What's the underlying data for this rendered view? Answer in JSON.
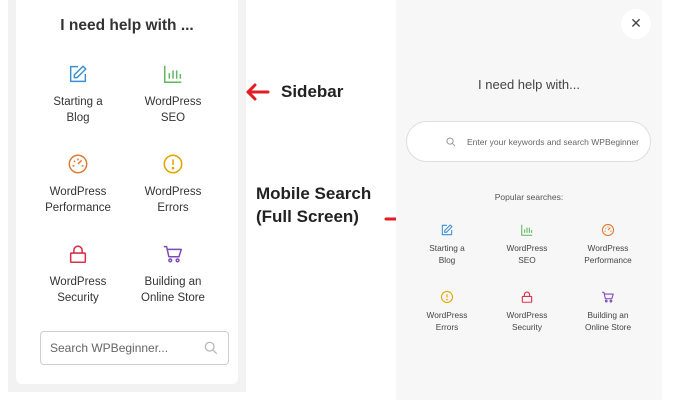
{
  "sidebar": {
    "title": "I need help with ...",
    "items": [
      {
        "line1": "Starting a",
        "line2": "Blog",
        "icon": "edit-icon",
        "color": "#3a8fd6"
      },
      {
        "line1": "WordPress",
        "line2": "SEO",
        "icon": "bar-chart-icon",
        "color": "#5cb85c"
      },
      {
        "line1": "WordPress",
        "line2": "Performance",
        "icon": "speedometer-icon",
        "color": "#e0782f"
      },
      {
        "line1": "WordPress",
        "line2": "Errors",
        "icon": "alert-icon",
        "color": "#e0a800"
      },
      {
        "line1": "WordPress",
        "line2": "Security",
        "icon": "lock-icon",
        "color": "#d9304b"
      },
      {
        "line1": "Building an",
        "line2": "Online Store",
        "icon": "cart-icon",
        "color": "#7b49b8"
      }
    ],
    "search_placeholder": "Search WPBeginner..."
  },
  "annotations": {
    "sidebar_label": "Sidebar",
    "mobile_line1": "Mobile Search",
    "mobile_line2": "(Full Screen)",
    "arrow_color": "#e31b23"
  },
  "mobile": {
    "close_glyph": "✕",
    "title": "I need help with...",
    "search_placeholder": "Enter your keywords and search WPBeginner",
    "popular_label": "Popular searches:",
    "items": [
      {
        "line1": "Starting a",
        "line2": "Blog",
        "icon": "edit-icon"
      },
      {
        "line1": "WordPress",
        "line2": "SEO",
        "icon": "bar-chart-icon"
      },
      {
        "line1": "WordPress",
        "line2": "Performance",
        "icon": "speedometer-icon"
      },
      {
        "line1": "WordPress",
        "line2": "Errors",
        "icon": "alert-icon"
      },
      {
        "line1": "WordPress",
        "line2": "Security",
        "icon": "lock-icon"
      },
      {
        "line1": "Building an",
        "line2": "Online Store",
        "icon": "cart-icon"
      }
    ]
  }
}
